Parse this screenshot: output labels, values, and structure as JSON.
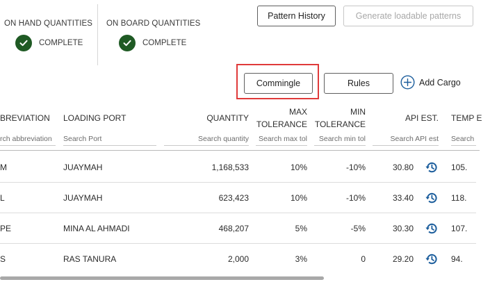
{
  "status": {
    "on_hand": {
      "label": "ON HAND QUANTITIES",
      "state": "COMPLETE",
      "icon": "check-icon"
    },
    "on_board": {
      "label": "ON BOARD QUANTITIES",
      "state": "COMPLETE",
      "icon": "check-icon"
    }
  },
  "actions": {
    "pattern_history": "Pattern History",
    "generate_patterns": "Generate loadable patterns",
    "commingle": "Commingle",
    "rules": "Rules",
    "add_cargo": "Add Cargo"
  },
  "colors": {
    "success": "#1f5a24",
    "accent": "#1b5d9c",
    "highlight": "#e03a3a"
  },
  "table": {
    "headers": {
      "abbreviation": "BREVIATION",
      "loading_port": "LOADING PORT",
      "quantity": "QUANTITY",
      "max_tol_1": "MAX",
      "max_tol_2": "TOLERANCE",
      "min_tol_1": "MIN",
      "min_tol_2": "TOLERANCE",
      "api_est": "API EST.",
      "temp_est": "TEMP E"
    },
    "placeholders": {
      "abbreviation": "rch abbreviation",
      "loading_port": "Search Port",
      "quantity": "Search quantity",
      "max_tol": "Search max tol",
      "min_tol": "Search min tol",
      "api_est": "Search API est",
      "temp_est": "Search T"
    },
    "rows": [
      {
        "abbr": "M",
        "port": "JUAYMAH",
        "quantity": "1,168,533",
        "max_tol": "10%",
        "min_tol": "-10%",
        "api": "30.80",
        "temp": "105."
      },
      {
        "abbr": "L",
        "port": "JUAYMAH",
        "quantity": "623,423",
        "max_tol": "10%",
        "min_tol": "-10%",
        "api": "33.40",
        "temp": "118."
      },
      {
        "abbr": "PE",
        "port": "MINA AL AHMADI",
        "quantity": "468,207",
        "max_tol": "5%",
        "min_tol": "-5%",
        "api": "30.30",
        "temp": "107."
      },
      {
        "abbr": "S",
        "port": "RAS TANURA",
        "quantity": "2,000",
        "max_tol": "3%",
        "min_tol": "0",
        "api": "29.20",
        "temp": "94."
      }
    ],
    "row_icon": "history-icon"
  }
}
